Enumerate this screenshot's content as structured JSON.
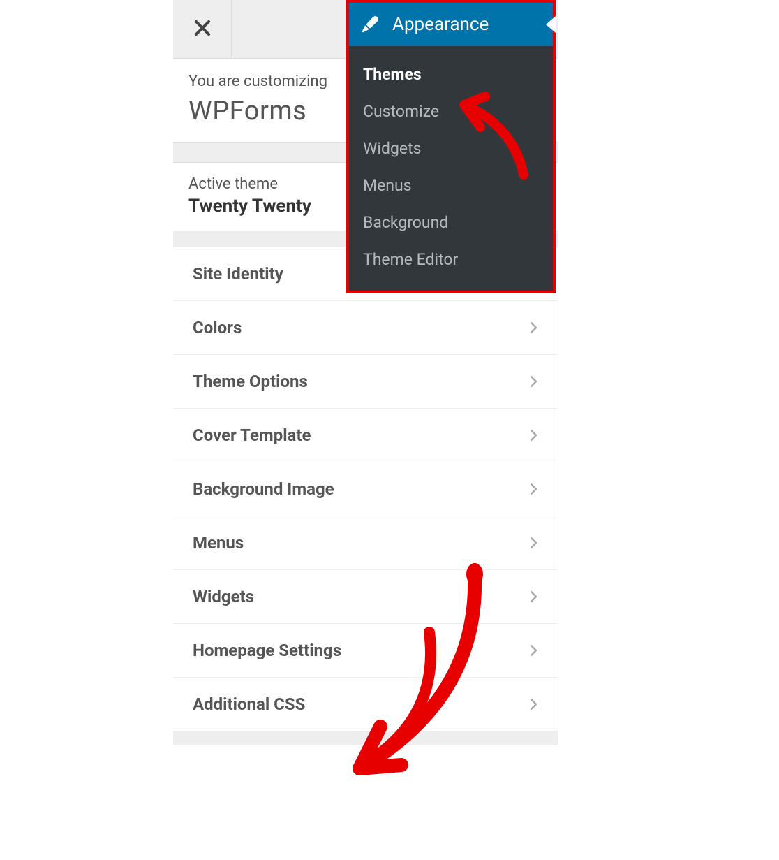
{
  "customizer": {
    "info_small": "You are customizing",
    "info_large": "WPForms",
    "active_theme_label": "Active theme",
    "active_theme_name": "Twenty Twenty",
    "sections": [
      {
        "label": "Site Identity"
      },
      {
        "label": "Colors"
      },
      {
        "label": "Theme Options"
      },
      {
        "label": "Cover Template"
      },
      {
        "label": "Background Image"
      },
      {
        "label": "Menus"
      },
      {
        "label": "Widgets"
      },
      {
        "label": "Homepage Settings"
      },
      {
        "label": "Additional CSS"
      }
    ]
  },
  "admin_flyout": {
    "title": "Appearance",
    "items": [
      {
        "label": "Themes",
        "current": true
      },
      {
        "label": "Customize",
        "current": false
      },
      {
        "label": "Widgets",
        "current": false
      },
      {
        "label": "Menus",
        "current": false
      },
      {
        "label": "Background",
        "current": false
      },
      {
        "label": "Theme Editor",
        "current": false
      }
    ]
  },
  "annotation_color": "#e60000"
}
